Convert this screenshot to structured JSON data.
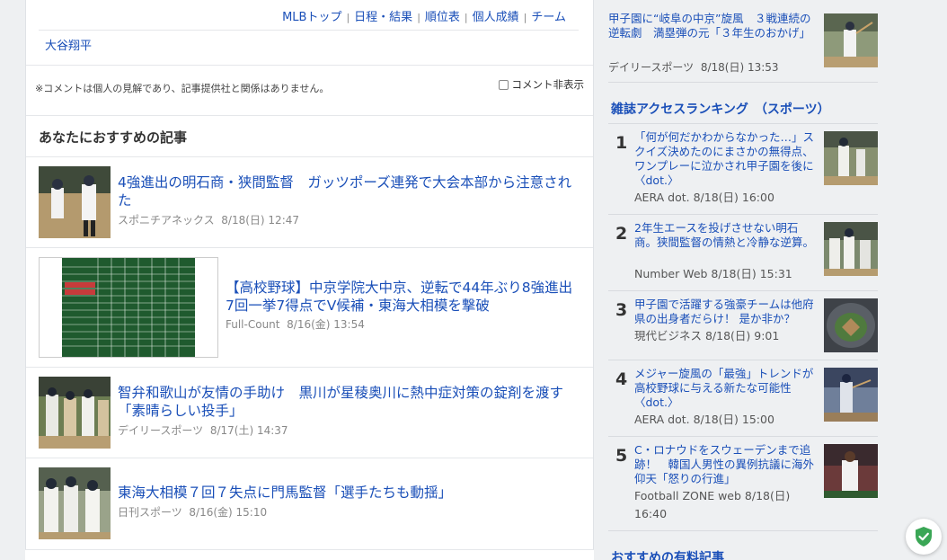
{
  "nav_links": [
    "MLBトップ",
    "日程・結果",
    "順位表",
    "個人成績",
    "チーム"
  ],
  "player_link": "大谷翔平",
  "disclaimer": "※コメントは個人の見解であり、記事提供社と関係はありません。",
  "comment_toggle_label": "コメント非表示",
  "recommended": {
    "heading": "あなたにおすすめの記事",
    "articles": [
      {
        "title": "4強進出の明石商・狭間監督　ガッツポーズ連発で大会本部から注意された",
        "source": "スポニチアネックス",
        "date": "8/18(日) 12:47"
      },
      {
        "title": "【高校野球】中京学院大中京、逆転で44年ぶり8強進出　7回一挙7得点でV候補・東海大相模を撃破",
        "source": "Full-Count",
        "date": "8/16(金) 13:54"
      },
      {
        "title": "智弁和歌山が友情の手助け　黒川が星稜奥川に熱中症対策の錠剤を渡す「素晴らしい投手」",
        "source": "デイリースポーツ",
        "date": "8/17(土) 14:37"
      },
      {
        "title": "東海大相模７回７失点に門馬監督「選手たちも動揺」",
        "source": "日刊スポーツ",
        "date": "8/16(金) 15:10"
      }
    ]
  },
  "sidebar": {
    "top_article": {
      "title": "甲子園に“岐阜の中京”旋風　３戦連続の逆転劇　満塁弾の元「３年生のおかげ」",
      "source": "デイリースポーツ",
      "date": "8/18(日) 13:53"
    },
    "ranking_heading": "雑誌アクセスランキング　（スポーツ）",
    "ranking": [
      {
        "rank": "1",
        "title": "「何が何だかわからなかった…」スクイズ決めたのにまさかの無得点、ワンプレーに泣かされ甲子園を後に〈dot.〉",
        "meta": "AERA dot. 8/18(日) 16:00"
      },
      {
        "rank": "2",
        "title": "2年生エースを投げさせない明石商。狭間監督の情熱と冷静な逆算。",
        "meta": "Number Web 8/18(日) 15:31"
      },
      {
        "rank": "3",
        "title": "甲子園で活躍する強豪チームは他府県の出身者だらけ！ 是か非か？",
        "meta": "現代ビジネス 8/18(日) 9:01"
      },
      {
        "rank": "4",
        "title": "メジャー旋風の「最強」トレンドが高校野球に与える新たな可能性〈dot.〉",
        "meta": "AERA dot. 8/18(日) 15:00"
      },
      {
        "rank": "5",
        "title": "C・ロナウドをスウェーデンまで追跡！　韓国人男性の異例抗議に海外仰天「怒りの行進」",
        "meta": "Football ZONE web 8/18(日) 16:40"
      }
    ],
    "paid_heading": "おすすめの有料記事"
  },
  "colors": {
    "link": "#1a4fb8",
    "background": "#eef0f2",
    "shield": "#3aa655"
  }
}
